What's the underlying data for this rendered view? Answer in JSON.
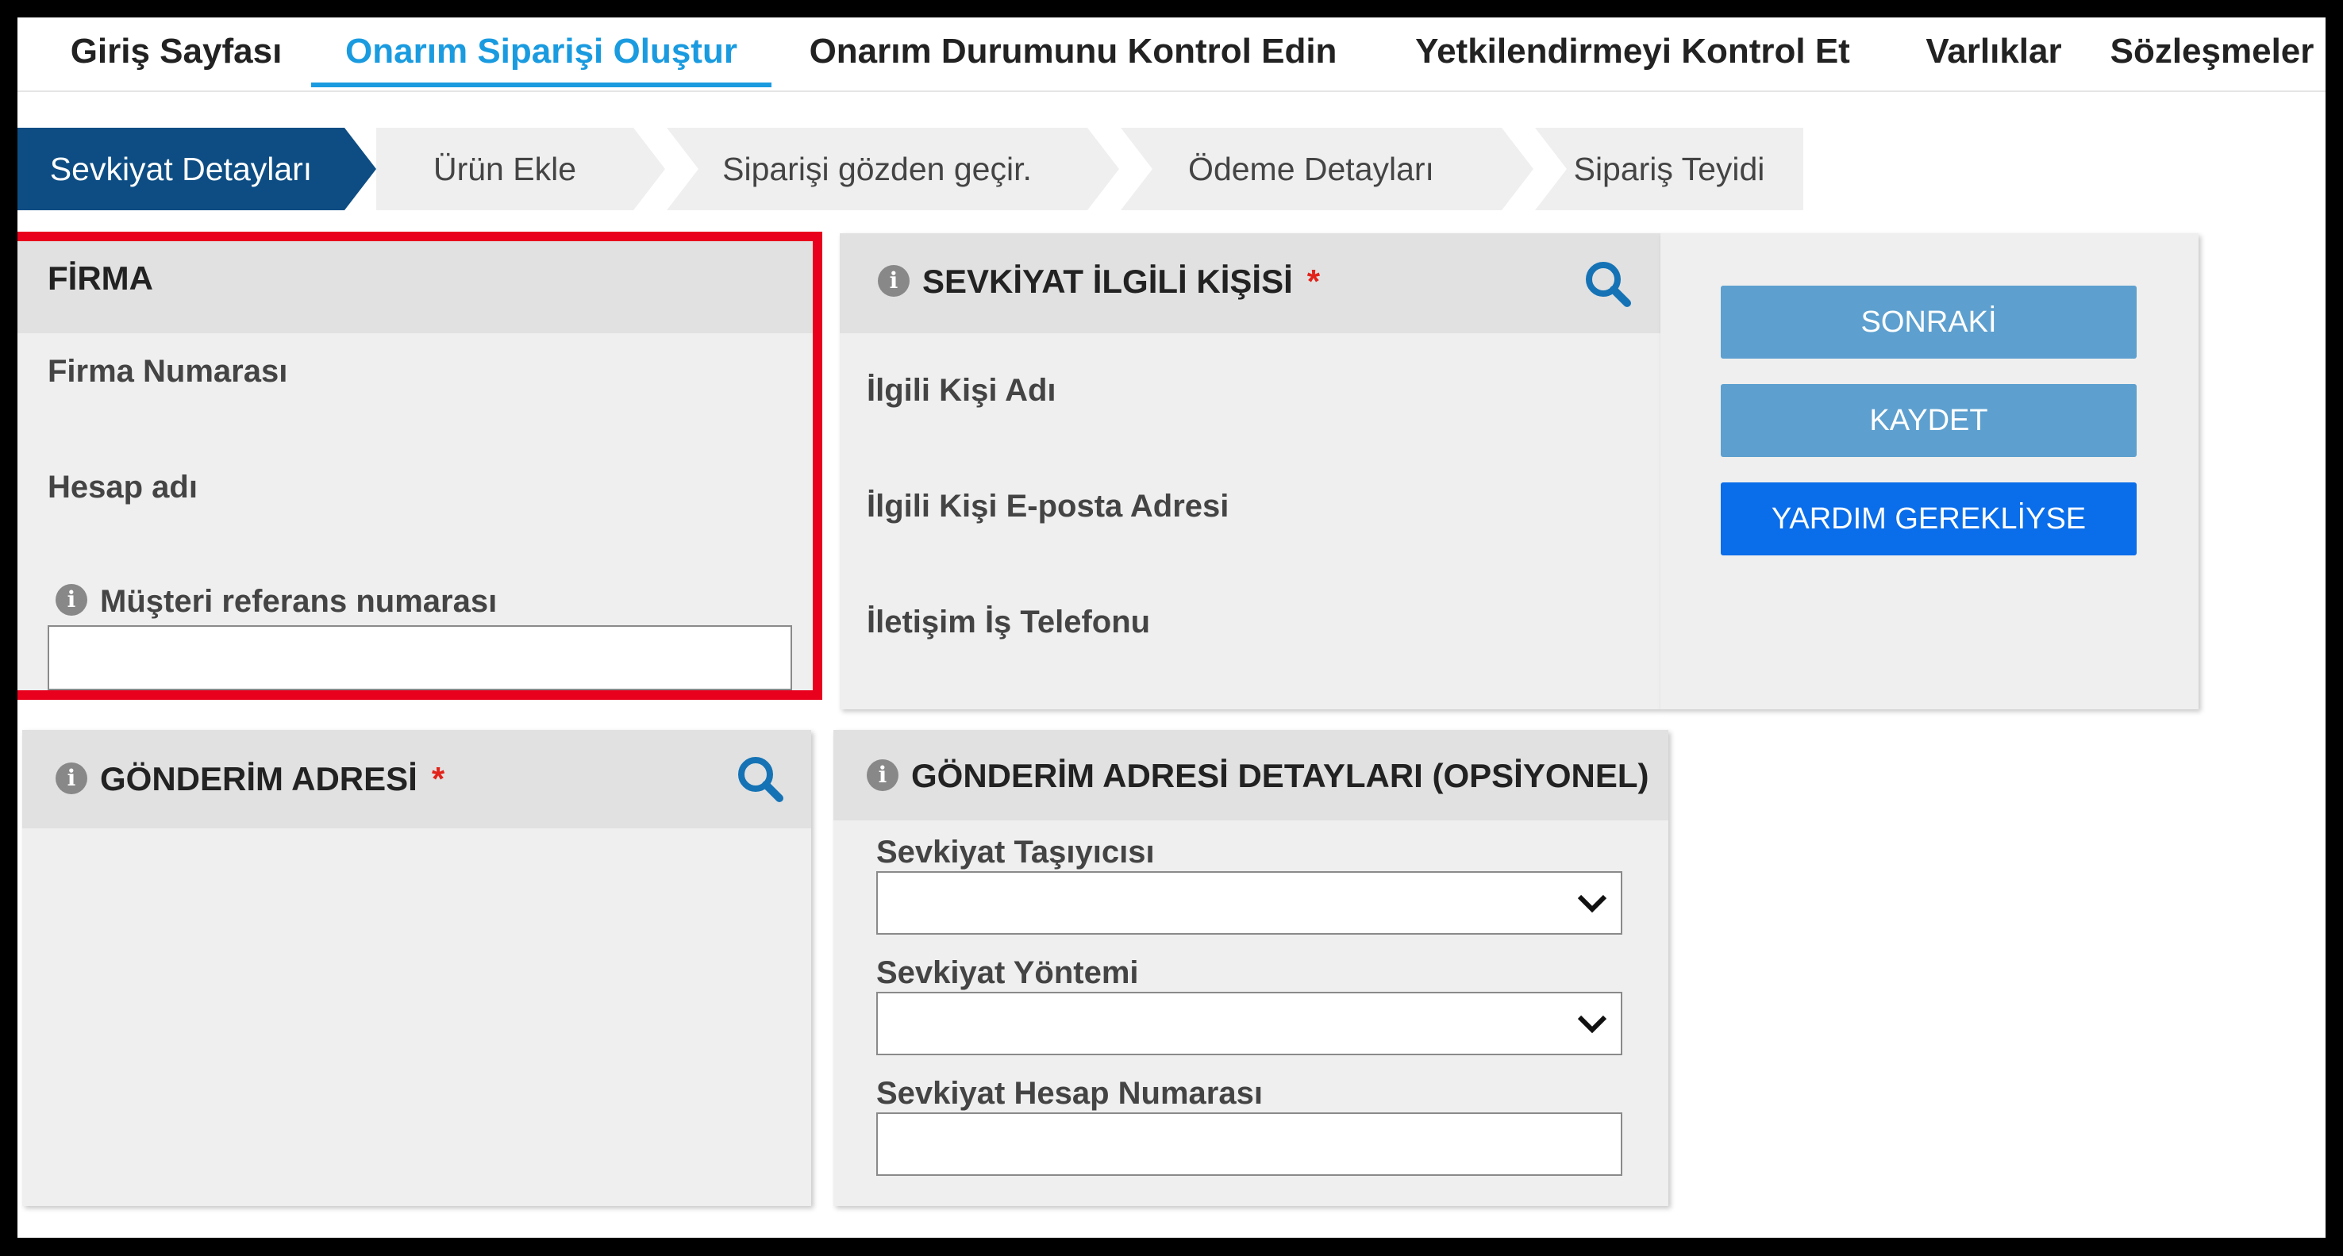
{
  "nav": {
    "items": [
      "Giriş Sayfası",
      "Onarım Siparişi Oluştur",
      "Onarım Durumunu Kontrol Edin",
      "Yetkilendirmeyi Kontrol Et",
      "Varlıklar",
      "Sözleşmeler"
    ],
    "active_index": 1
  },
  "steps": [
    "Sevkiyat Detayları",
    "Ürün Ekle",
    "Siparişi gözden geçir.",
    "Ödeme Detayları",
    "Sipariş Teyidi"
  ],
  "firma": {
    "title": "FİRMA",
    "company_number_label": "Firma Numarası",
    "account_name_label": "Hesap adı",
    "customer_ref_label": "Müşteri referans numarası",
    "customer_ref_value": ""
  },
  "contact": {
    "title": "SEVKİYAT İLGİLİ KİŞİSİ",
    "required_mark": "*",
    "name_label": "İlgili Kişi Adı",
    "email_label": "İlgili Kişi E-posta Adresi",
    "phone_label": "İletişim İş Telefonu"
  },
  "actions": {
    "next": "SONRAKİ",
    "save": "KAYDET",
    "help": "YARDIM GEREKLİYSE"
  },
  "shipping_address": {
    "title": "GÖNDERİM ADRESİ",
    "required_mark": "*"
  },
  "shipping_details": {
    "title": "GÖNDERİM ADRESİ DETAYLARI (OPSİYONEL)",
    "carrier_label": "Sevkiyat Taşıyıcısı",
    "carrier_value": "",
    "method_label": "Sevkiyat Yöntemi",
    "method_value": "",
    "account_label": "Sevkiyat Hesap Numarası",
    "account_value": ""
  },
  "colors": {
    "active_tab": "#1a9be0",
    "step_active": "#0d4d83",
    "btn_light": "#5da0cf",
    "btn_primary": "#0a6de9",
    "required": "#e2231a",
    "highlight": "#e8001c"
  },
  "icons": [
    "info-icon",
    "search-icon",
    "chevron-down-icon"
  ]
}
